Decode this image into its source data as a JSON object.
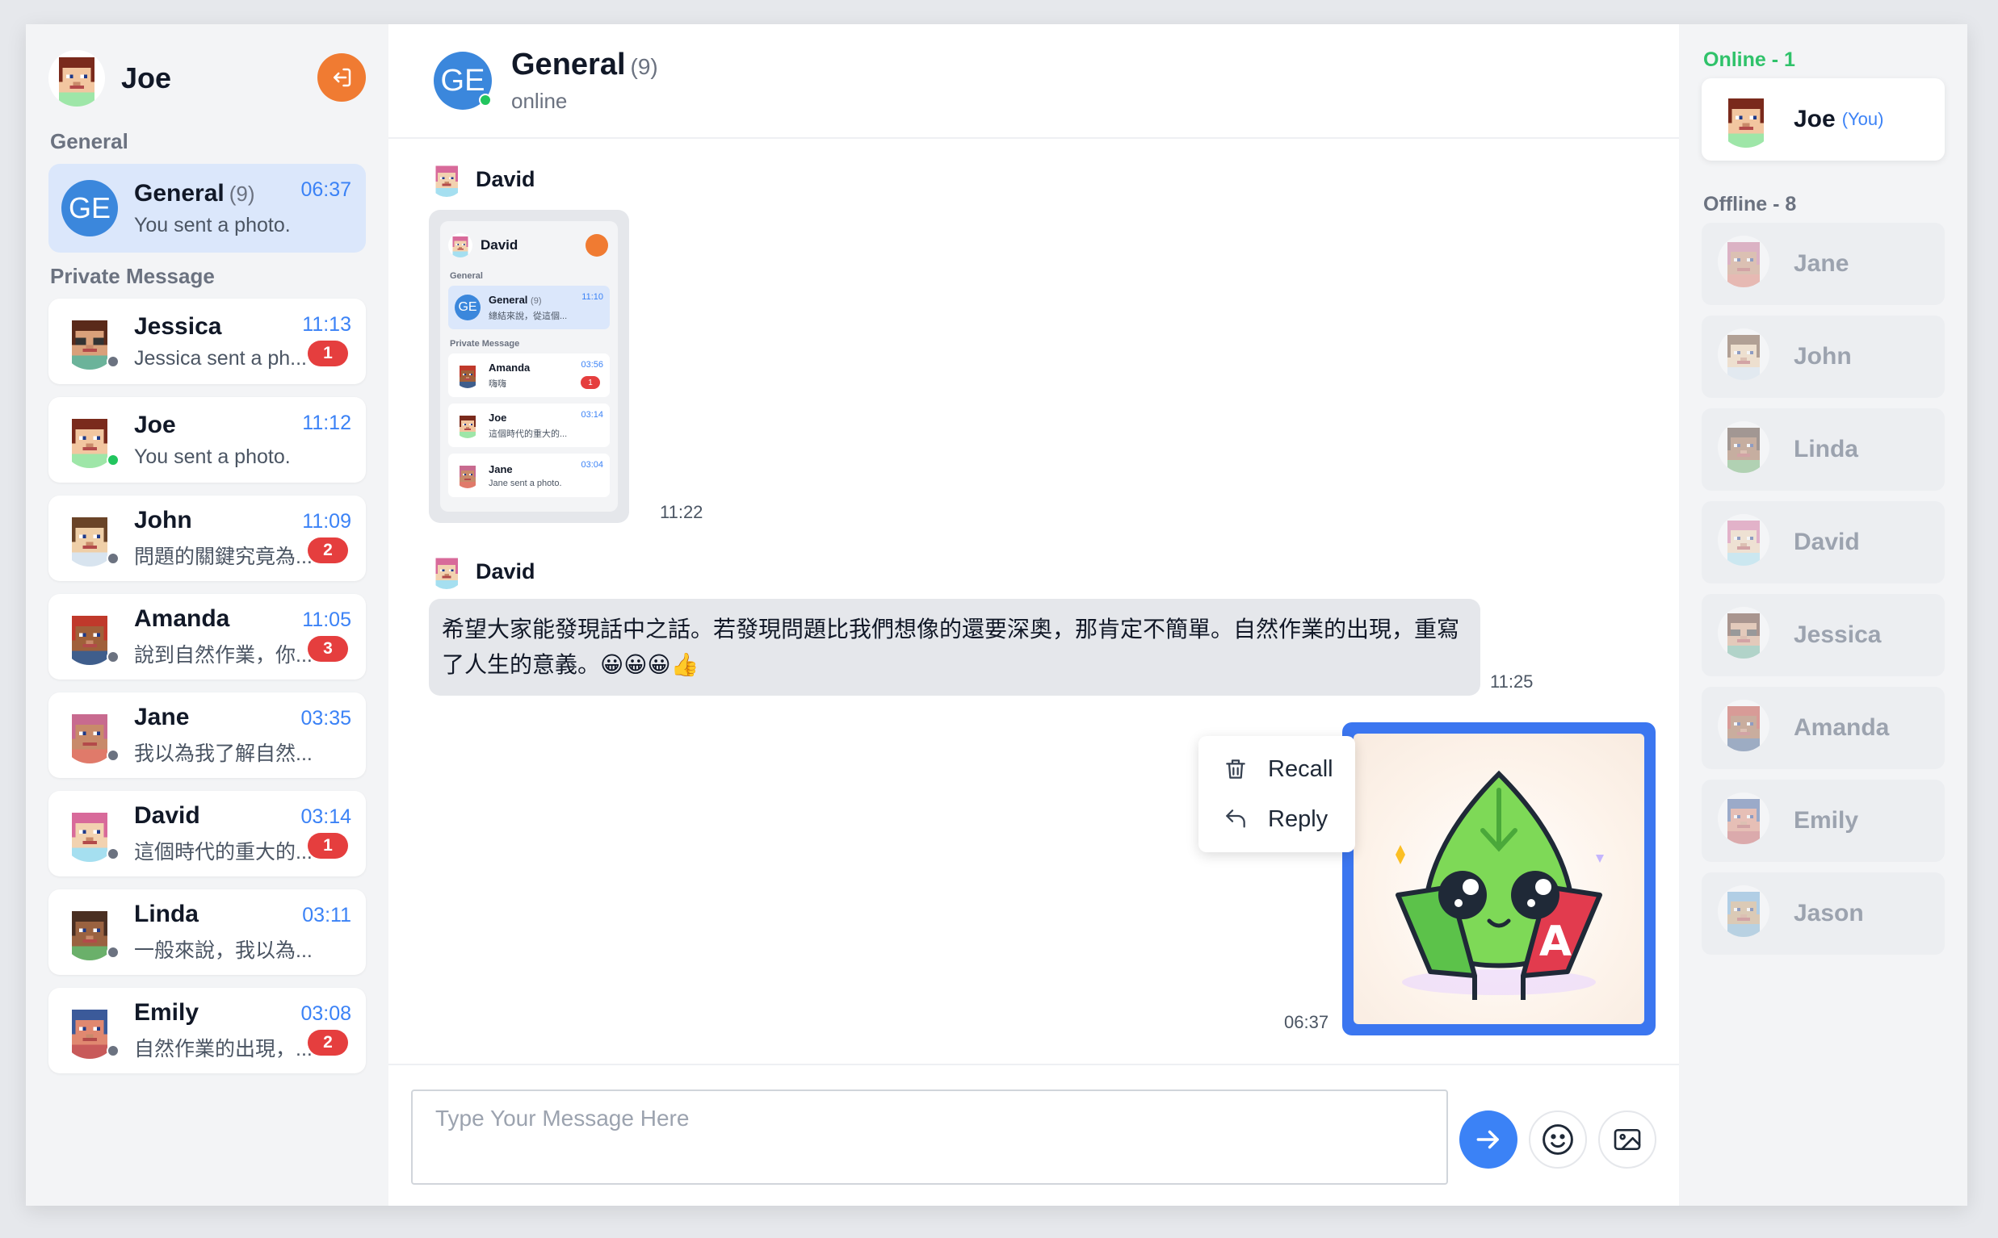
{
  "current_user": {
    "name": "Joe"
  },
  "sidebar": {
    "general_label": "General",
    "private_label": "Private Message",
    "group": {
      "initials": "GE",
      "title": "General",
      "count": "(9)",
      "time": "06:37",
      "last_message": "You sent a photo."
    },
    "dms": [
      {
        "name": "Jessica",
        "time": "11:13",
        "preview": "Jessica sent a ph...",
        "badge": "1",
        "status": "offline",
        "avatar": "jessica"
      },
      {
        "name": "Joe",
        "time": "11:12",
        "preview": "You sent a photo.",
        "badge": "",
        "status": "online",
        "avatar": "joe"
      },
      {
        "name": "John",
        "time": "11:09",
        "preview": "問題的關鍵究竟為...",
        "badge": "2",
        "status": "offline",
        "avatar": "john"
      },
      {
        "name": "Amanda",
        "time": "11:05",
        "preview": "說到自然作業，你...",
        "badge": "3",
        "status": "offline",
        "avatar": "amanda"
      },
      {
        "name": "Jane",
        "time": "03:35",
        "preview": "我以為我了解自然...",
        "badge": "",
        "status": "offline",
        "avatar": "jane"
      },
      {
        "name": "David",
        "time": "03:14",
        "preview": "這個時代的重大的...",
        "badge": "1",
        "status": "offline",
        "avatar": "david"
      },
      {
        "name": "Linda",
        "time": "03:11",
        "preview": "一般來說，我以為...",
        "badge": "",
        "status": "offline",
        "avatar": "linda"
      },
      {
        "name": "Emily",
        "time": "03:08",
        "preview": "自然作業的出現，...",
        "badge": "2",
        "status": "offline",
        "avatar": "emily"
      }
    ]
  },
  "chat": {
    "initials": "GE",
    "title": "General",
    "count": "(9)",
    "status": "online",
    "messages": [
      {
        "sender": "David",
        "type": "image",
        "time": "11:22"
      },
      {
        "sender": "David",
        "type": "text",
        "text": "希望大家能發現話中之話。若發現問題比我們想像的還要深奧，那肯定不簡單。自然作業的出現，重寫了人生的意義。😀😀😀👍",
        "time": "11:25"
      },
      {
        "sender": "You",
        "type": "image",
        "time": "06:37"
      }
    ],
    "screenshot_preview": {
      "user": "David",
      "general_label": "General",
      "private_label": "Private Message",
      "group": {
        "initials": "GE",
        "title": "General",
        "count": "(9)",
        "time": "11:10",
        "preview": "總結來說，從這個..."
      },
      "dms": [
        {
          "name": "Amanda",
          "time": "03:56",
          "preview": "嗨嗨",
          "badge": "1"
        },
        {
          "name": "Joe",
          "time": "03:14",
          "preview": "這個時代的重大的..."
        },
        {
          "name": "Jane",
          "time": "03:04",
          "preview": "Jane sent a photo."
        }
      ]
    },
    "context_menu": {
      "recall": "Recall",
      "reply": "Reply"
    },
    "composer": {
      "placeholder": "Type Your Message Here"
    }
  },
  "members": {
    "online_label": "Online - 1",
    "offline_label": "Offline - 8",
    "online": [
      {
        "name": "Joe",
        "suffix": "(You)",
        "avatar": "joe"
      }
    ],
    "offline": [
      {
        "name": "Jane",
        "avatar": "jane"
      },
      {
        "name": "John",
        "avatar": "john"
      },
      {
        "name": "Linda",
        "avatar": "linda"
      },
      {
        "name": "David",
        "avatar": "david"
      },
      {
        "name": "Jessica",
        "avatar": "jessica"
      },
      {
        "name": "Amanda",
        "avatar": "amanda"
      },
      {
        "name": "Emily",
        "avatar": "emily"
      },
      {
        "name": "Jason",
        "avatar": "jason"
      }
    ]
  },
  "colors": {
    "accent": "#3b82f6",
    "logout": "#f07b32",
    "badge": "#e53e3e",
    "online": "#22c55e",
    "group_avatar": "#3b87dc"
  }
}
